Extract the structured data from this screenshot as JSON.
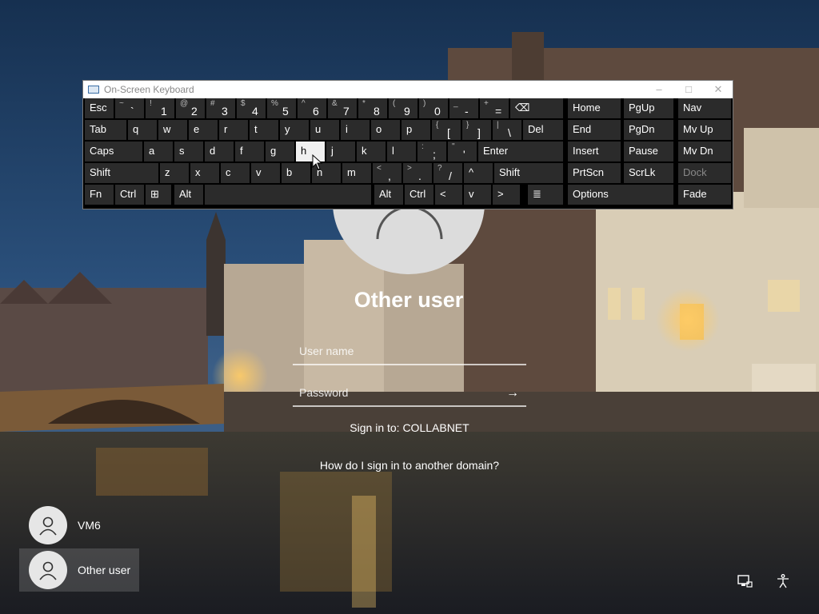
{
  "login": {
    "title": "Other user",
    "username_placeholder": "User name",
    "password_placeholder": "Password",
    "sign_in_to": "Sign in to: COLLABNET",
    "domain_help_link": "How do I sign in to another domain?"
  },
  "users": [
    {
      "name": "VM6",
      "avatar_icon": "person-icon"
    },
    {
      "name": "Other user",
      "avatar_icon": "person-icon",
      "selected": true
    }
  ],
  "system_tray": {
    "network_icon": "network-icon",
    "accessibility_icon": "accessibility-icon"
  },
  "osk": {
    "title": "On-Screen Keyboard",
    "window_buttons": {
      "minimize": "–",
      "maximize": "□",
      "close": "✕"
    },
    "rows": [
      [
        {
          "id": "esc",
          "label": "Esc"
        },
        {
          "id": "tilde",
          "top": "~",
          "main": "`"
        },
        {
          "id": "1",
          "top": "!",
          "main": "1"
        },
        {
          "id": "2",
          "top": "@",
          "main": "2"
        },
        {
          "id": "3",
          "top": "#",
          "main": "3"
        },
        {
          "id": "4",
          "top": "$",
          "main": "4"
        },
        {
          "id": "5",
          "top": "%",
          "main": "5"
        },
        {
          "id": "6",
          "top": "^",
          "main": "6"
        },
        {
          "id": "7",
          "top": "&",
          "main": "7"
        },
        {
          "id": "8",
          "top": "*",
          "main": "8"
        },
        {
          "id": "9",
          "top": "(",
          "main": "9"
        },
        {
          "id": "0",
          "top": ")",
          "main": "0"
        },
        {
          "id": "minus",
          "top": "_",
          "main": "-"
        },
        {
          "id": "equals",
          "top": "+",
          "main": "="
        },
        {
          "id": "backspace",
          "label": "⌫"
        },
        {
          "id": "home",
          "label": "Home"
        },
        {
          "id": "pgup",
          "label": "PgUp"
        },
        {
          "id": "nav",
          "label": "Nav"
        }
      ],
      [
        {
          "id": "tab",
          "label": "Tab"
        },
        {
          "id": "q",
          "label": "q"
        },
        {
          "id": "w",
          "label": "w"
        },
        {
          "id": "e",
          "label": "e"
        },
        {
          "id": "r",
          "label": "r"
        },
        {
          "id": "t",
          "label": "t"
        },
        {
          "id": "y",
          "label": "y"
        },
        {
          "id": "u",
          "label": "u"
        },
        {
          "id": "i",
          "label": "i"
        },
        {
          "id": "o",
          "label": "o"
        },
        {
          "id": "p",
          "label": "p"
        },
        {
          "id": "lbracket",
          "top": "{",
          "main": "["
        },
        {
          "id": "rbracket",
          "top": "}",
          "main": "]"
        },
        {
          "id": "backslash",
          "top": "|",
          "main": "\\"
        },
        {
          "id": "del",
          "label": "Del"
        },
        {
          "id": "end",
          "label": "End"
        },
        {
          "id": "pgdn",
          "label": "PgDn"
        },
        {
          "id": "mvup",
          "label": "Mv Up"
        }
      ],
      [
        {
          "id": "caps",
          "label": "Caps"
        },
        {
          "id": "a",
          "label": "a"
        },
        {
          "id": "s",
          "label": "s"
        },
        {
          "id": "d",
          "label": "d"
        },
        {
          "id": "f",
          "label": "f"
        },
        {
          "id": "g",
          "label": "g"
        },
        {
          "id": "h",
          "label": "h",
          "pressed": true
        },
        {
          "id": "j",
          "label": "j"
        },
        {
          "id": "k",
          "label": "k"
        },
        {
          "id": "l",
          "label": "l"
        },
        {
          "id": "semicolon",
          "top": ":",
          "main": ";"
        },
        {
          "id": "quote",
          "top": "\"",
          "main": "'"
        },
        {
          "id": "enter",
          "label": "Enter"
        },
        {
          "id": "insert",
          "label": "Insert"
        },
        {
          "id": "pause",
          "label": "Pause"
        },
        {
          "id": "mvdn",
          "label": "Mv Dn"
        }
      ],
      [
        {
          "id": "lshift",
          "label": "Shift"
        },
        {
          "id": "z",
          "label": "z"
        },
        {
          "id": "x",
          "label": "x"
        },
        {
          "id": "c",
          "label": "c"
        },
        {
          "id": "v",
          "label": "v"
        },
        {
          "id": "b",
          "label": "b"
        },
        {
          "id": "n",
          "label": "n"
        },
        {
          "id": "m",
          "label": "m"
        },
        {
          "id": "comma",
          "top": "<",
          "main": ","
        },
        {
          "id": "period",
          "top": ">",
          "main": "."
        },
        {
          "id": "slash",
          "top": "?",
          "main": "/"
        },
        {
          "id": "up",
          "label": "^"
        },
        {
          "id": "rshift",
          "label": "Shift"
        },
        {
          "id": "prtscn",
          "label": "PrtScn"
        },
        {
          "id": "scrlk",
          "label": "ScrLk"
        },
        {
          "id": "dock",
          "label": "Dock",
          "disabled": true
        }
      ],
      [
        {
          "id": "fn",
          "label": "Fn"
        },
        {
          "id": "lctrl",
          "label": "Ctrl"
        },
        {
          "id": "win",
          "label": "⊞"
        },
        {
          "id": "lalt",
          "label": "Alt"
        },
        {
          "id": "space",
          "label": ""
        },
        {
          "id": "ralt",
          "label": "Alt"
        },
        {
          "id": "rctrl",
          "label": "Ctrl"
        },
        {
          "id": "left",
          "label": "<"
        },
        {
          "id": "down",
          "label": "v"
        },
        {
          "id": "right",
          "label": ">"
        },
        {
          "id": "menu",
          "label": "≣"
        },
        {
          "id": "options",
          "label": "Options"
        },
        {
          "id": "fade",
          "label": "Fade"
        }
      ]
    ]
  }
}
